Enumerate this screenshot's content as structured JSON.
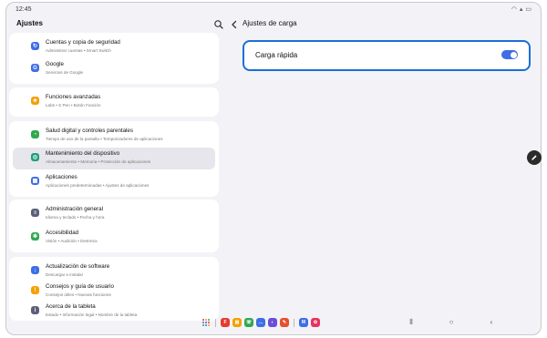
{
  "status_bar": {
    "time": "12:45",
    "icons": [
      "wifi-icon",
      "signal-icon",
      "battery-icon"
    ]
  },
  "left_panel": {
    "title": "Ajustes",
    "search_icon": "search-icon",
    "groups": [
      {
        "items": [
          {
            "icon": "backup-icon",
            "color": "#3e6ee6",
            "title": "Cuentas y copia de seguridad",
            "subtitle": "Administrar cuentas  •  Smart Switch"
          },
          {
            "icon": "google-icon",
            "color": "#3e6ee6",
            "title": "Google",
            "subtitle": "Servicios de Google"
          }
        ]
      },
      {
        "items": [
          {
            "icon": "advanced-features-icon",
            "color": "#f4a000",
            "title": "Funciones avanzadas",
            "subtitle": "Labs  •  S Pen  •  Botón Función"
          }
        ]
      },
      {
        "items": [
          {
            "icon": "digital-wellbeing-icon",
            "color": "#2fa84f",
            "title": "Salud digital y controles parentales",
            "subtitle": "Tiempo de uso de la pantalla  •  Temporizadores de aplicaciones"
          },
          {
            "icon": "device-care-icon",
            "color": "#1e9e7a",
            "title": "Mantenimiento del dispositivo",
            "subtitle": "Almacenamiento  •  Memoria  •  Protección de aplicaciones",
            "selected": true
          },
          {
            "icon": "apps-icon",
            "color": "#3e6ee6",
            "title": "Aplicaciones",
            "subtitle": "Aplicaciones predeterminadas  •  Ajustes de aplicaciones"
          }
        ]
      },
      {
        "items": [
          {
            "icon": "general-management-icon",
            "color": "#5b5f7a",
            "title": "Administración general",
            "subtitle": "Idioma y teclado  •  Fecha y hora"
          },
          {
            "icon": "accessibility-icon",
            "color": "#2fa84f",
            "title": "Accesibilidad",
            "subtitle": "Visión  •  Audición  •  Destreza"
          }
        ]
      },
      {
        "items": [
          {
            "icon": "software-update-icon",
            "color": "#3e6ee6",
            "title": "Actualización de software",
            "subtitle": "Descargar e instalar"
          },
          {
            "icon": "tips-icon",
            "color": "#f4a000",
            "title": "Consejos y guía de usuario",
            "subtitle": "Consejos útiles  •  Nuevas funciones"
          },
          {
            "icon": "about-tablet-icon",
            "color": "#5b5f7a",
            "title": "Acerca de la tableta",
            "subtitle": "Estado  •  Información legal  •  Nombre de la tableta"
          }
        ]
      }
    ]
  },
  "right_panel": {
    "back_icon": "back-arrow-icon",
    "title": "Ajustes de carga",
    "fast_charging": {
      "label": "Carga rápida",
      "enabled": true,
      "accent": "#1a6fd8"
    }
  },
  "floating": {
    "pen_icon": "pen-icon"
  },
  "dock": {
    "apps": [
      {
        "icon": "app-drawer-icon"
      },
      {
        "icon": "flipboard-icon",
        "color": "#e63b2e"
      },
      {
        "icon": "my-files-icon",
        "color": "#f4a000"
      },
      {
        "icon": "phone-icon",
        "color": "#2fa84f"
      },
      {
        "icon": "messages-icon",
        "color": "#3e6ee6"
      },
      {
        "icon": "internet-icon",
        "color": "#6a4fd8"
      },
      {
        "icon": "samsung-notes-icon",
        "color": "#e6512e"
      },
      {
        "icon": "samsung-members-icon",
        "color": "#3e6ee6"
      },
      {
        "icon": "gallery-icon",
        "color": "#e6335f"
      }
    ],
    "nav": [
      "recents-icon",
      "home-icon",
      "back-icon"
    ]
  }
}
